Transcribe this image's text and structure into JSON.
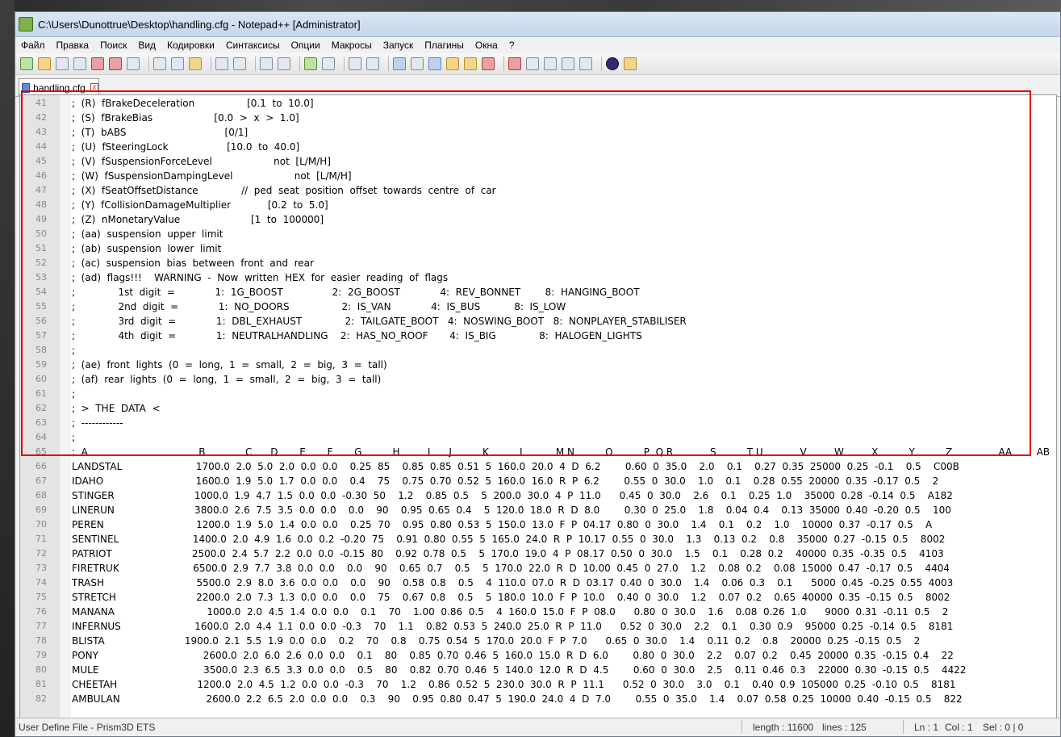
{
  "window": {
    "title": "C:\\Users\\Dunottrue\\Desktop\\handling.cfg - Notepad++ [Administrator]"
  },
  "menu": [
    "Файл",
    "Правка",
    "Поиск",
    "Вид",
    "Кодировки",
    "Синтаксисы",
    "Опции",
    "Макросы",
    "Запуск",
    "Плагины",
    "Окна",
    "?"
  ],
  "toolbar": {
    "icons": [
      "new-file-icon",
      "open-file-icon",
      "save-icon",
      "save-all-icon",
      "close-icon",
      "close-all-icon",
      "print-icon",
      "cut-icon",
      "copy-icon",
      "paste-icon",
      "undo-icon",
      "redo-icon",
      "find-icon",
      "replace-icon",
      "zoom-in-icon",
      "zoom-out-icon",
      "sync-vertical-icon",
      "sync-horizontal-icon",
      "word-wrap-icon",
      "show-all-chars-icon",
      "indent-guide-icon",
      "user-define-icon",
      "doc-map-icon",
      "function-list-icon",
      "record-macro-icon",
      "stop-record-icon",
      "play-macro-icon",
      "run-macro-multiple-icon",
      "save-macro-icon",
      "plugin-icon",
      "shortcut-icon"
    ]
  },
  "tab": {
    "label": "handling.cfg",
    "close_symbol": "x"
  },
  "highlight_color": "#e00000",
  "editor": {
    "lines": [
      {
        "n": "41",
        "t": ";  (R)  fBrakeDeceleration                 [0.1  to  10.0]"
      },
      {
        "n": "42",
        "t": ";  (S)  fBrakeBias                    [0.0  >  x  >  1.0]"
      },
      {
        "n": "43",
        "t": ";  (T)  bABS                                [0/1]"
      },
      {
        "n": "44",
        "t": ";  (U)  fSteeringLock                   [10.0  to  40.0]"
      },
      {
        "n": "45",
        "t": ";  (V)  fSuspensionForceLevel                    not  [L/M/H]"
      },
      {
        "n": "46",
        "t": ";  (W)  fSuspensionDampingLevel                    not  [L/M/H]"
      },
      {
        "n": "47",
        "t": ";  (X)  fSeatOffsetDistance              //  ped  seat  position  offset  towards  centre  of  car"
      },
      {
        "n": "48",
        "t": ";  (Y)  fCollisionDamageMultiplier            [0.2  to  5.0]"
      },
      {
        "n": "49",
        "t": ";  (Z)  nMonetaryValue                       [1  to  100000]"
      },
      {
        "n": "50",
        "t": ";  (aa)  suspension  upper  limit"
      },
      {
        "n": "51",
        "t": ";  (ab)  suspension  lower  limit"
      },
      {
        "n": "52",
        "t": ";  (ac)  suspension  bias  between  front  and  rear"
      },
      {
        "n": "53",
        "t": ";  (ad)  flags!!!    WARNING  -  Now  written  HEX  for  easier  reading  of  flags"
      },
      {
        "n": "54",
        "t": ";              1st  digit  =             1:  1G_BOOST                2:  2G_BOOST             4:  REV_BONNET        8:  HANGING_BOOT"
      },
      {
        "n": "55",
        "t": ";              2nd  digit  =             1:  NO_DOORS                 2:  IS_VAN             4:  IS_BUS           8:  IS_LOW"
      },
      {
        "n": "56",
        "t": ";              3rd  digit  =             1:  DBL_EXHAUST              2:  TAILGATE_BOOT   4:  NOSWING_BOOT   8:  NONPLAYER_STABILISER"
      },
      {
        "n": "57",
        "t": ";              4th  digit  =             1:  NEUTRALHANDLING    2:  HAS_NO_ROOF       4:  IS_BIG              8:  HALOGEN_LIGHTS"
      },
      {
        "n": "58",
        "t": ";"
      },
      {
        "n": "59",
        "t": ";  (ae)  front  lights  (0  =  long,  1  =  small,  2  =  big,  3  =  tall)"
      },
      {
        "n": "60",
        "t": ";  (af)  rear  lights  (0  =  long,  1  =  small,  2  =  big,  3  =  tall)"
      },
      {
        "n": "61",
        "t": ";"
      },
      {
        "n": "62",
        "t": ";  >  THE  DATA  <"
      },
      {
        "n": "63",
        "t": ";  ------------"
      },
      {
        "n": "64",
        "t": ";"
      },
      {
        "n": "65",
        "t": ";  A                                    B             C      D       E       F       G          H         I      J          K          L          M N          O          P  Q R            S          T U            V         W         X          Y          Z               AA        AB          AC          AD"
      },
      {
        "n": "66",
        "t": "LANDSTAL                        1700.0  2.0  5.0  2.0  0.0  0.0    0.25  85    0.85  0.85  0.51  5  160.0  20.0  4  D  6.2        0.60  0  35.0    2.0    0.1    0.27  0.35  25000  0.25  -0.1    0.5    C00B"
      },
      {
        "n": "67",
        "t": "IDAHO                              1600.0  1.9  5.0  1.7  0.0  0.0    0.4    75    0.75  0.70  0.52  5  160.0  16.0  R  P  6.2        0.55  0  30.0    1.0    0.1    0.28  0.55  20000  0.35  -0.17  0.5    2"
      },
      {
        "n": "68",
        "t": "STINGER                          1000.0  1.9  4.7  1.5  0.0  0.0  -0.30  50    1.2    0.85  0.5    5  200.0  30.0  4  P  11.0      0.45  0  30.0    2.6    0.1    0.25  1.0    35000  0.28  -0.14  0.5    A182"
      },
      {
        "n": "69",
        "t": "LINERUN                          3800.0  2.6  7.5  3.5  0.0  0.0    0.0    90    0.95  0.65  0.4    5  120.0  18.0  R  D  8.0        0.30  0  25.0    1.8    0.04  0.4    0.13  35000  0.40  -0.20  0.5    100"
      },
      {
        "n": "70",
        "t": "PEREN                              1200.0  1.9  5.0  1.4  0.0  0.0    0.25  70    0.95  0.80  0.53  5  150.0  13.0  F  P  04.17  0.80  0  30.0    1.4    0.1    0.2    1.0    10000  0.37  -0.17  0.5    A"
      },
      {
        "n": "71",
        "t": "SENTINEL                        1400.0  2.0  4.9  1.6  0.0  0.2  -0.20  75    0.91  0.80  0.55  5  165.0  24.0  R  P  10.17  0.55  0  30.0    1.3    0.13  0.2    0.8    35000  0.27  -0.15  0.5    8002"
      },
      {
        "n": "72",
        "t": "PATRIOT                          2500.0  2.4  5.7  2.2  0.0  0.0  -0.15  80    0.92  0.78  0.5    5  170.0  19.0  4  P  08.17  0.50  0  30.0    1.5    0.1    0.28  0.2    40000  0.35  -0.35  0.5    4103"
      },
      {
        "n": "73",
        "t": "FIRETRUK                        6500.0  2.9  7.7  3.8  0.0  0.0    0.0    90    0.65  0.7    0.5    5  170.0  22.0  R  D  10.00  0.45  0  27.0    1.2    0.08  0.2    0.08  15000  0.47  -0.17  0.5    4404"
      },
      {
        "n": "74",
        "t": "TRASH                              5500.0  2.9  8.0  3.6  0.0  0.0    0.0    90    0.58  0.8    0.5    4  110.0  07.0  R  D  03.17  0.40  0  30.0    1.4    0.06  0.3    0.1      5000  0.45  -0.25  0.55  4003"
      },
      {
        "n": "75",
        "t": "STRETCH                          2200.0  2.0  7.3  1.3  0.0  0.0    0.0    75    0.67  0.8    0.5    5  180.0  10.0  F  P  10.0    0.40  0  30.0    1.2    0.07  0.2    0.65  40000  0.35  -0.15  0.5    8002"
      },
      {
        "n": "76",
        "t": "MANANA                              1000.0  2.0  4.5  1.4  0.0  0.0    0.1    70    1.00  0.86  0.5    4  160.0  15.0  F  P  08.0      0.80  0  30.0    1.6    0.08  0.26  1.0      9000  0.31  -0.11  0.5    2"
      },
      {
        "n": "77",
        "t": "INFERNUS                        1600.0  2.0  4.4  1.1  0.0  0.0  -0.3    70    1.1    0.82  0.53  5  240.0  25.0  R  P  11.0      0.52  0  30.0    2.2    0.1    0.30  0.9    95000  0.25  -0.14  0.5    8181"
      },
      {
        "n": "78",
        "t": "BLISTA                          1900.0  2.1  5.5  1.9  0.0  0.0    0.2    70    0.8    0.75  0.54  5  170.0  20.0  F  P  7.0      0.65  0  30.0    1.4    0.11  0.2    0.8    20000  0.25  -0.15  0.5    2"
      },
      {
        "n": "79",
        "t": "PONY                                  2600.0  2.0  6.0  2.6  0.0  0.0    0.1    80    0.85  0.70  0.46  5  160.0  15.0  R  D  6.0        0.80  0  30.0    2.2    0.07  0.2    0.45  20000  0.35  -0.15  0.4    22"
      },
      {
        "n": "80",
        "t": "MULE                                  3500.0  2.3  6.5  3.3  0.0  0.0    0.5    80    0.82  0.70  0.46  5  140.0  12.0  R  D  4.5        0.60  0  30.0    2.5    0.11  0.46  0.3    22000  0.30  -0.15  0.5    4422"
      },
      {
        "n": "81",
        "t": "CHEETAH                          1200.0  2.0  4.5  1.2  0.0  0.0  -0.3    70    1.2    0.86  0.52  5  230.0  30.0  R  P  11.1      0.52  0  30.0    3.0    0.1    0.40  0.9  105000  0.25  -0.10  0.5    8181"
      },
      {
        "n": "82",
        "t": "AMBULAN                            2600.0  2.2  6.5  2.0  0.0  0.0    0.3    90    0.95  0.80  0.47  5  190.0  24.0  4  D  7.0        0.55  0  35.0    1.4    0.07  0.58  0.25  10000  0.40  -0.15  0.5    822"
      }
    ]
  },
  "status": {
    "file_type": "User Define File - Prism3D ETS",
    "length": "length : 11600",
    "lines": "lines : 125",
    "ln": "Ln : 1",
    "col": "Col : 1",
    "sel": "Sel : 0 | 0"
  }
}
